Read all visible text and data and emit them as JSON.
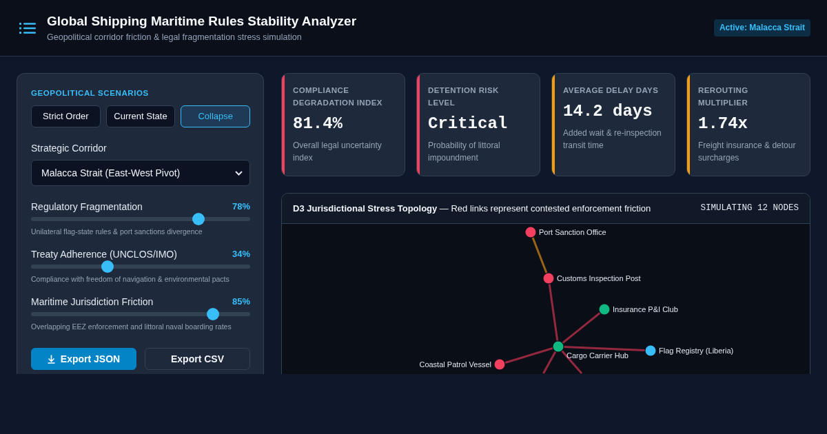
{
  "header": {
    "title": "Global Shipping Maritime Rules Stability Analyzer",
    "subtitle": "Geopolitical corridor friction & legal fragmentation stress simulation",
    "badge": "Active: Malacca Strait"
  },
  "controls": {
    "section_title": "GEOPOLITICAL SCENARIOS",
    "scenarios": [
      {
        "label": "Strict Order",
        "selected": false
      },
      {
        "label": "Current State",
        "selected": false
      },
      {
        "label": "Collapse",
        "selected": true
      }
    ],
    "corridor": {
      "label": "Strategic Corridor",
      "value": "Malacca Strait (East-West Pivot)"
    },
    "sliders": [
      {
        "label": "Regulatory Fragmentation",
        "value": "78%",
        "level": 0.78,
        "note": "Unilateral flag-state rules & port sanctions divergence"
      },
      {
        "label": "Treaty Adherence (UNCLOS/IMO)",
        "value": "34%",
        "level": 0.34,
        "note": "Compliance with freedom of navigation & environmental pacts"
      },
      {
        "label": "Maritime Jurisdiction Friction",
        "value": "85%",
        "level": 0.85,
        "note": "Overlapping EEZ enforcement and littoral naval boarding rates"
      }
    ],
    "export_buttons": [
      {
        "label": "Export JSON",
        "kind": "primary"
      },
      {
        "label": "Export CSV",
        "kind": "outline"
      }
    ]
  },
  "metrics": [
    {
      "title": "COMPLIANCE DEGRADATION INDEX",
      "value": "81.4%",
      "description": "Overall legal uncertainty index",
      "color": "#f43f5e"
    },
    {
      "title": "DETENTION RISK LEVEL",
      "value": "Critical",
      "description": "Probability of littoral impoundment",
      "color": "#f43f5e"
    },
    {
      "title": "AVERAGE DELAY DAYS",
      "value": "14.2 days",
      "description": "Added wait & re-inspection transit time",
      "color": "#f59e0b"
    },
    {
      "title": "REROUTING MULTIPLIER",
      "value": "1.74x",
      "description": "Freight insurance & detour surcharges",
      "color": "#f59e0b"
    }
  ],
  "topology": {
    "title": "**D3 Jurisdictional Stress Topology** — Red links represent contested enforcement friction",
    "status": "SIMULATING 12 NODES",
    "nodes": [
      {
        "label": "Port Sanction Office",
        "color": "#f43f5e",
        "children": [
          {
            "label": "Customs Inspection Post",
            "color": "#f43f5e",
            "link": {
              "color": "#9a6417"
            },
            "children": [
              {
                "label": "Cargo Carrier Hub",
                "color": "#10b981",
                "link": {
                  "color": "#94283f"
                },
                "children": [
                  {
                    "label": "Insurance P&I Club",
                    "color": "#10b981",
                    "link": {
                      "color": "#94283f"
                    }
                  },
                  {
                    "label": "Flag Registry (Liberia)",
                    "color": "#38bdf8",
                    "link": {
                      "color": "#94283f"
                    }
                  },
                  {
                    "label": "Coastal Patrol Vessel",
                    "color": "#f43f5e",
                    "link": {
                      "color": "#94283f"
                    }
                  },
                  {
                    "link": {
                      "color": "#94283f"
                    }
                  },
                  {
                    "link": {
                      "color": "#94283f"
                    }
                  }
                ]
              }
            ]
          }
        ]
      }
    ]
  }
}
